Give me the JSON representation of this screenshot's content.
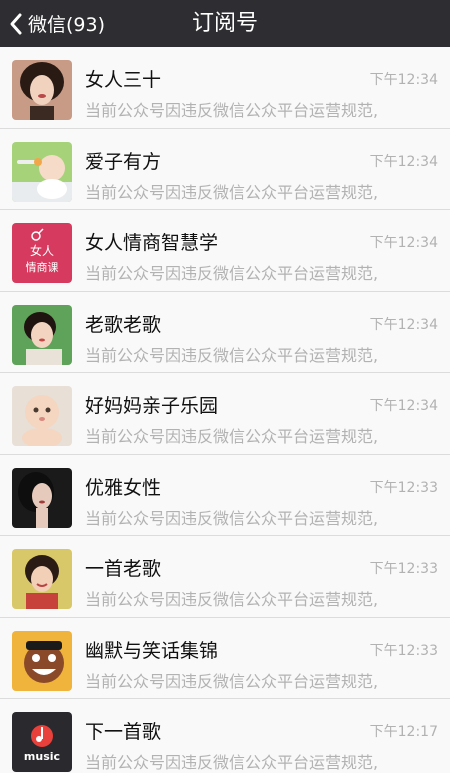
{
  "nav": {
    "back_label": "微信(93)",
    "title": "订阅号"
  },
  "items": [
    {
      "name": "女人三十",
      "time": "下午12:34",
      "snippet": "当前公众号因违反微信公众平台运营规范,",
      "avatar": "woman-portrait-avatar"
    },
    {
      "name": "爱子有方",
      "time": "下午12:34",
      "snippet": "当前公众号因违反微信公众平台运营规范,",
      "avatar": "baby-feeding-avatar"
    },
    {
      "name": "女人情商智慧学",
      "time": "下午12:34",
      "snippet": "当前公众号因违反微信公众平台运营规范,",
      "avatar": "pink-logo-avatar",
      "avatar_text": [
        "女人",
        "情商课"
      ]
    },
    {
      "name": "老歌老歌",
      "time": "下午12:34",
      "snippet": "当前公众号因违反微信公众平台运营规范,",
      "avatar": "singer-portrait-avatar"
    },
    {
      "name": "好妈妈亲子乐园",
      "time": "下午12:34",
      "snippet": "当前公众号因违反微信公众平台运营规范,",
      "avatar": "baby-portrait-avatar"
    },
    {
      "name": "优雅女性",
      "time": "下午12:33",
      "snippet": "当前公众号因违反微信公众平台运营规范,",
      "avatar": "elegant-woman-avatar"
    },
    {
      "name": "一首老歌",
      "time": "下午12:33",
      "snippet": "当前公众号因违反微信公众平台运营规范,",
      "avatar": "smiling-singer-avatar"
    },
    {
      "name": "幽默与笑话集锦",
      "time": "下午12:33",
      "snippet": "当前公众号因违反微信公众平台运营规范,",
      "avatar": "cartoon-face-avatar"
    },
    {
      "name": "下一首歌",
      "time": "下午12:17",
      "snippet": "当前公众号因违反微信公众平台运营规范,",
      "avatar": "music-logo-avatar",
      "avatar_text": [
        "music"
      ]
    }
  ],
  "colors": {
    "navbar": "#2e2e32",
    "background": "#f9f9f9",
    "text_primary": "#111111",
    "text_secondary": "#b2b2b2"
  }
}
